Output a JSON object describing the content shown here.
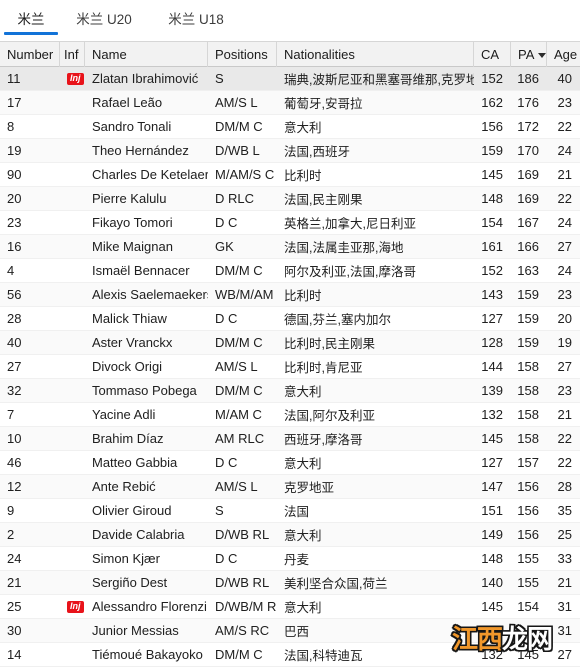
{
  "tabs": [
    {
      "label": "米兰",
      "active": true
    },
    {
      "label": "米兰 U20",
      "active": false
    },
    {
      "label": "米兰 U18",
      "active": false
    }
  ],
  "table": {
    "columns": [
      {
        "key": "number",
        "label": "Number"
      },
      {
        "key": "inf",
        "label": "Inf"
      },
      {
        "key": "name",
        "label": "Name"
      },
      {
        "key": "positions",
        "label": "Positions"
      },
      {
        "key": "nationalities",
        "label": "Nationalities"
      },
      {
        "key": "ca",
        "label": "CA"
      },
      {
        "key": "pa",
        "label": "PA",
        "sorted": true,
        "sort_direction": "desc"
      },
      {
        "key": "age",
        "label": "Age"
      }
    ],
    "rows": [
      {
        "number": "11",
        "inf": "Inj",
        "name": "Zlatan Ibrahimović",
        "positions": "S",
        "nationalities": "瑞典,波斯尼亚和黑塞哥维那,克罗地亚",
        "ca": "152",
        "pa": "186",
        "age": "40"
      },
      {
        "number": "17",
        "inf": "",
        "name": "Rafael Leão",
        "positions": "AM/S L",
        "nationalities": "葡萄牙,安哥拉",
        "ca": "162",
        "pa": "176",
        "age": "23"
      },
      {
        "number": "8",
        "inf": "",
        "name": "Sandro Tonali",
        "positions": "DM/M C",
        "nationalities": "意大利",
        "ca": "156",
        "pa": "172",
        "age": "22"
      },
      {
        "number": "19",
        "inf": "",
        "name": "Theo Hernández",
        "positions": "D/WB L",
        "nationalities": "法国,西班牙",
        "ca": "159",
        "pa": "170",
        "age": "24"
      },
      {
        "number": "90",
        "inf": "",
        "name": "Charles De Ketelaere",
        "positions": "M/AM/S C",
        "nationalities": "比利时",
        "ca": "145",
        "pa": "169",
        "age": "21"
      },
      {
        "number": "20",
        "inf": "",
        "name": "Pierre Kalulu",
        "positions": "D RLC",
        "nationalities": "法国,民主刚果",
        "ca": "148",
        "pa": "169",
        "age": "22"
      },
      {
        "number": "23",
        "inf": "",
        "name": "Fikayo Tomori",
        "positions": "D C",
        "nationalities": "英格兰,加拿大,尼日利亚",
        "ca": "154",
        "pa": "167",
        "age": "24"
      },
      {
        "number": "16",
        "inf": "",
        "name": "Mike Maignan",
        "positions": "GK",
        "nationalities": "法国,法属圭亚那,海地",
        "ca": "161",
        "pa": "166",
        "age": "27"
      },
      {
        "number": "4",
        "inf": "",
        "name": "Ismaël Bennacer",
        "positions": "DM/M C",
        "nationalities": "阿尔及利亚,法国,摩洛哥",
        "ca": "152",
        "pa": "163",
        "age": "24"
      },
      {
        "number": "56",
        "inf": "",
        "name": "Alexis Saelemaekers",
        "positions": "WB/M/AM R",
        "nationalities": "比利时",
        "ca": "143",
        "pa": "159",
        "age": "23"
      },
      {
        "number": "28",
        "inf": "",
        "name": "Malick Thiaw",
        "positions": "D C",
        "nationalities": "德国,芬兰,塞内加尔",
        "ca": "127",
        "pa": "159",
        "age": "20"
      },
      {
        "number": "40",
        "inf": "",
        "name": "Aster Vranckx",
        "positions": "DM/M C",
        "nationalities": "比利时,民主刚果",
        "ca": "128",
        "pa": "159",
        "age": "19"
      },
      {
        "number": "27",
        "inf": "",
        "name": "Divock Origi",
        "positions": "AM/S L",
        "nationalities": "比利时,肯尼亚",
        "ca": "144",
        "pa": "158",
        "age": "27"
      },
      {
        "number": "32",
        "inf": "",
        "name": "Tommaso Pobega",
        "positions": "DM/M C",
        "nationalities": "意大利",
        "ca": "139",
        "pa": "158",
        "age": "23"
      },
      {
        "number": "7",
        "inf": "",
        "name": "Yacine Adli",
        "positions": "M/AM C",
        "nationalities": "法国,阿尔及利亚",
        "ca": "132",
        "pa": "158",
        "age": "21"
      },
      {
        "number": "10",
        "inf": "",
        "name": "Brahim Díaz",
        "positions": "AM RLC",
        "nationalities": "西班牙,摩洛哥",
        "ca": "145",
        "pa": "158",
        "age": "22"
      },
      {
        "number": "46",
        "inf": "",
        "name": "Matteo Gabbia",
        "positions": "D C",
        "nationalities": "意大利",
        "ca": "127",
        "pa": "157",
        "age": "22"
      },
      {
        "number": "12",
        "inf": "",
        "name": "Ante Rebić",
        "positions": "AM/S L",
        "nationalities": "克罗地亚",
        "ca": "147",
        "pa": "156",
        "age": "28"
      },
      {
        "number": "9",
        "inf": "",
        "name": "Olivier Giroud",
        "positions": "S",
        "nationalities": "法国",
        "ca": "151",
        "pa": "156",
        "age": "35"
      },
      {
        "number": "2",
        "inf": "",
        "name": "Davide Calabria",
        "positions": "D/WB RL",
        "nationalities": "意大利",
        "ca": "149",
        "pa": "156",
        "age": "25"
      },
      {
        "number": "24",
        "inf": "",
        "name": "Simon Kjær",
        "positions": "D C",
        "nationalities": "丹麦",
        "ca": "148",
        "pa": "155",
        "age": "33"
      },
      {
        "number": "21",
        "inf": "",
        "name": "Sergiño Dest",
        "positions": "D/WB RL",
        "nationalities": "美利坚合众国,荷兰",
        "ca": "140",
        "pa": "155",
        "age": "21"
      },
      {
        "number": "25",
        "inf": "Inj",
        "name": "Alessandro Florenzi",
        "positions": "D/WB/M R",
        "nationalities": "意大利",
        "ca": "145",
        "pa": "154",
        "age": "31"
      },
      {
        "number": "30",
        "inf": "",
        "name": "Junior Messias",
        "positions": "AM/S RC",
        "nationalities": "巴西",
        "ca": "",
        "pa": "",
        "age": "31"
      },
      {
        "number": "14",
        "inf": "",
        "name": "Tiémoué Bakayoko",
        "positions": "DM/M C",
        "nationalities": "法国,科特迪瓦",
        "ca": "132",
        "pa": "145",
        "age": "27"
      }
    ]
  },
  "watermark": {
    "characters": [
      {
        "text": "江",
        "color": "#f0972b"
      },
      {
        "text": "西",
        "color": "#f0972b"
      },
      {
        "text": "龙",
        "color": "#ffffff"
      },
      {
        "text": "网",
        "color": "#ffffff"
      }
    ]
  },
  "colors": {
    "accent": "#1273d8",
    "injury_badge": "#e8131a",
    "header_bg": "#f2f2f2"
  }
}
